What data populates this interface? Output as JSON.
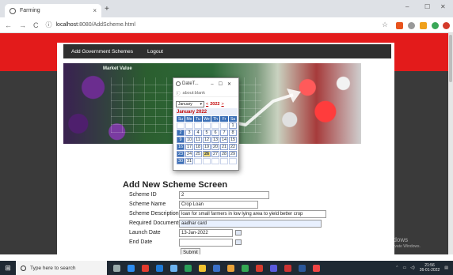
{
  "browser": {
    "tab_title": "Farming",
    "tab_close": "×",
    "new_tab": "+",
    "url_host": "localhost",
    "url_path": ":8080/AddScheme.html",
    "win_min": "–",
    "win_max": "☐",
    "win_close": "✕"
  },
  "menu": {
    "items": [
      "Add Government Schemes",
      "Logout"
    ]
  },
  "banner": {
    "title": "Market Value"
  },
  "form": {
    "title": "Add New Scheme Screen",
    "labels": {
      "scheme_id": "Scheme ID",
      "scheme_name": "Scheme Name",
      "scheme_description": "Scheme Description",
      "required_documents": "Required Documents",
      "launch_date": "Launch  Date",
      "end_date": "End Date"
    },
    "values": {
      "scheme_id": "2",
      "scheme_name": "Crop Loan",
      "scheme_description": "loan for small farmers in low lying area to yield better crop",
      "required_documents": "aadhar card",
      "launch_date": "13-Jan-2022",
      "end_date": ""
    },
    "submit_label": "Submit"
  },
  "popup": {
    "title": "DateT...",
    "address": "about:blank",
    "month_select": "January",
    "year": "2022",
    "prev_arrow": "<",
    "next_arrow": ">",
    "month_title": "January 2022",
    "weekdays": [
      "Su",
      "Mo",
      "Tu",
      "We",
      "Th",
      "Fr",
      "Sa"
    ],
    "weeks": [
      [
        "",
        "",
        "",
        "",
        "",
        "",
        "1"
      ],
      [
        "2",
        "3",
        "4",
        "5",
        "6",
        "7",
        "8"
      ],
      [
        "9",
        "10",
        "11",
        "12",
        "13",
        "14",
        "15"
      ],
      [
        "16",
        "17",
        "18",
        "19",
        "20",
        "21",
        "22"
      ],
      [
        "23",
        "24",
        "25",
        "26",
        "27",
        "28",
        "29"
      ],
      [
        "30",
        "31",
        "",
        "",
        "",
        "",
        ""
      ]
    ],
    "today": "26"
  },
  "watermark": {
    "line1": "Activate Windows",
    "line2": "Go to Settings to activate Windows."
  },
  "taskbar": {
    "search_placeholder": "Type here to search",
    "time": "21:56",
    "date": "26-01-2022"
  },
  "colors": {
    "header_red": "#e31b1b",
    "menubar": "#2f2f2f",
    "calendar_blue": "#3b6fb6",
    "today": "#f4dd7a"
  }
}
